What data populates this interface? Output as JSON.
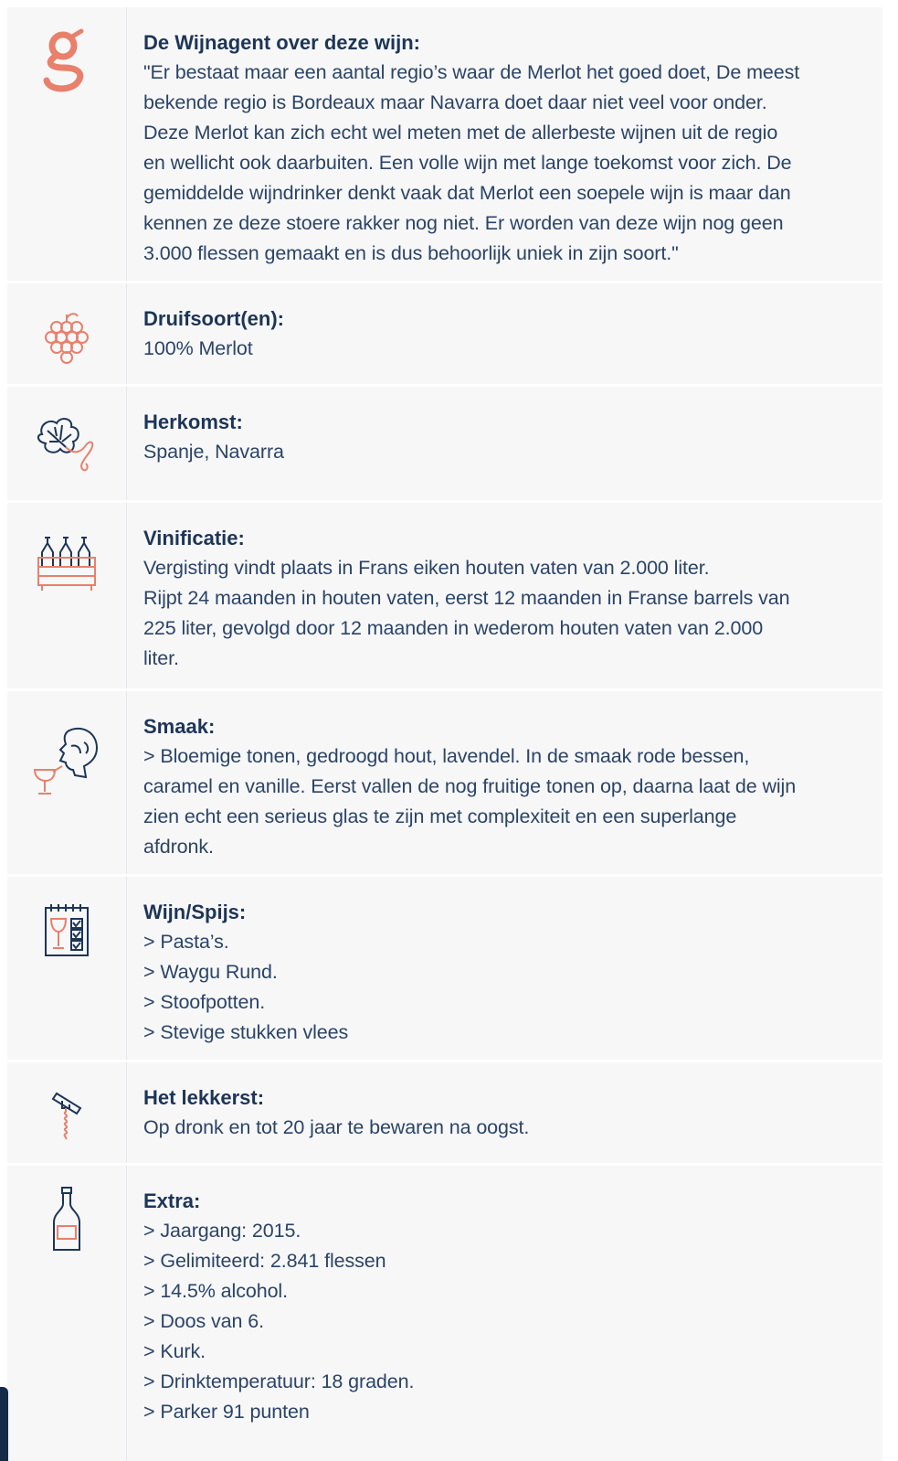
{
  "sections": {
    "review": {
      "title": "De Wijnagent over deze wijn:",
      "lines": [
        "\"Er bestaat maar een aantal regio’s waar de Merlot het goed doet, De meest",
        "bekende regio is Bordeaux maar Navarra doet daar niet veel voor onder.",
        "Deze Merlot kan zich echt wel meten met de allerbeste wijnen uit de regio",
        "en wellicht ook daarbuiten. Een volle wijn met lange toekomst voor zich. De",
        "gemiddelde wijndrinker denkt vaak dat Merlot een soepele wijn is maar dan",
        "kennen ze deze stoere rakker nog niet. Er worden van deze wijn nog geen",
        "3.000 flessen gemaakt en is dus behoorlijk uniek in zijn soort.\""
      ]
    },
    "grapes": {
      "title": "Druifsoort(en):",
      "lines": [
        "100% Merlot"
      ]
    },
    "origin": {
      "title": "Herkomst:",
      "lines": [
        "Spanje, Navarra"
      ]
    },
    "vinification": {
      "title": "Vinificatie:",
      "lines": [
        "Vergisting vindt plaats in Frans eiken houten vaten van 2.000 liter.",
        "Rijpt 24 maanden in houten vaten, eerst 12 maanden in Franse barrels van",
        "225 liter, gevolgd door 12 maanden in wederom houten vaten van 2.000",
        "liter."
      ]
    },
    "taste": {
      "title": "Smaak:",
      "lines": [
        "> Bloemige tonen, gedroogd hout, lavendel. In de smaak rode bessen,",
        "caramel en vanille. Eerst vallen de nog fruitige tonen op, daarna laat de wijn",
        "zien echt een serieus glas te zijn met complexiteit en een superlange",
        "afdronk."
      ]
    },
    "pairing": {
      "title": "Wijn/Spijs:",
      "lines": [
        "> Pasta’s.",
        "> Waygu Rund.",
        "> Stoofpotten.",
        "> Stevige stukken vlees"
      ]
    },
    "drinking": {
      "title": "Het lekkerst:",
      "lines": [
        "Op dronk en tot 20 jaar te bewaren na oogst."
      ]
    },
    "extra": {
      "title": "Extra:",
      "lines": [
        "> Jaargang: 2015.",
        "> Gelimiteerd: 2.841 flessen",
        "> 14.5% alcohol.",
        "> Doos van 6.",
        "> Kurk.",
        "> Drinktemperatuur: 18 graden.",
        "> Parker 91 punten"
      ]
    }
  },
  "icons": {
    "review": "wijnagent-logo-icon",
    "grapes": "grapes-icon",
    "origin": "vine-leaf-icon",
    "vinification": "wine-crate-icon",
    "taste": "tasting-face-icon",
    "pairing": "menu-checklist-icon",
    "drinking": "corkscrew-icon",
    "extra": "wine-bottle-icon"
  },
  "colors": {
    "accent": "#e8806b",
    "navy": "#1d3557",
    "panel": "#f7f7f7"
  }
}
